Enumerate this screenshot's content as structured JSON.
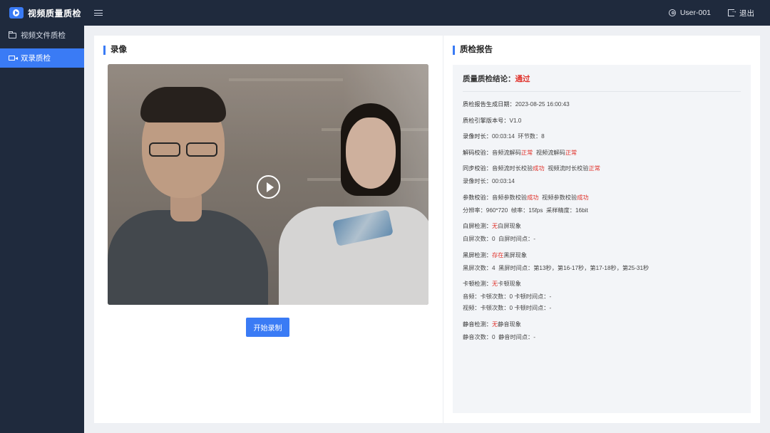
{
  "app": {
    "title": "视频质量质检"
  },
  "header": {
    "user": "User-001",
    "logout": "退出"
  },
  "sidebar": {
    "items": [
      {
        "label": "视频文件质检",
        "active": false
      },
      {
        "label": "双录质检",
        "active": true
      }
    ]
  },
  "recording": {
    "title": "录像",
    "start_button": "开始录制"
  },
  "report": {
    "title": "质检报告",
    "conclusion_label": "质量质检结论：",
    "conclusion_value": "通过",
    "lines": {
      "gen_date_label": "质检报告生成日期：",
      "gen_date": "2023-08-25 16:00:43",
      "engine_label": "质检引擎版本号：",
      "engine": "V1.0",
      "duration_label": "录像时长：",
      "duration": "00:03:14",
      "segments_label": "环节数：",
      "segments": "8",
      "decode_label": "解码校验：",
      "decode_audio": "音频流解码",
      "decode_audio_status": "正常",
      "decode_video": "视频流解码",
      "decode_video_status": "正常",
      "sync_label": "同步校验：",
      "sync_audio": "音频流时长校验",
      "sync_audio_status": "成功",
      "sync_video": "视频流时长校验",
      "sync_video_status": "正常",
      "rec_duration_label": "录像时长：",
      "rec_duration": "00:03:14",
      "param_label": "参数校验：",
      "param_audio": "音频参数校验",
      "param_audio_status": "成功",
      "param_video": "视频参数校验",
      "param_video_status": "成功",
      "resolution_label": "分辨率：",
      "resolution": "960*720",
      "fps_label": "帧率：",
      "fps": "15fps",
      "bitdepth_label": "采样精度：",
      "bitdepth": "16bit",
      "white_label": "白屏检测：",
      "white_status": "无",
      "white_text": "白屏现象",
      "white_count_label": "白屏次数：",
      "white_count": "0",
      "white_time_label": "白屏时间点：",
      "white_time": "-",
      "black_label": "黑屏检测：",
      "black_status": "存在",
      "black_text": "黑屏现象",
      "black_count_label": "黑屏次数：",
      "black_count": "4",
      "black_time_label": "黑屏时间点：",
      "black_time": "第13秒，第16-17秒，第17-18秒，第25-31秒",
      "lag_label": "卡顿检测：",
      "lag_status": "无",
      "lag_text": "卡顿现象",
      "lag_audio": "音频：卡顿次数：0   卡顿时间点：-",
      "lag_video": "视频：卡顿次数：0   卡顿时间点：-",
      "mute_label": "静音检测：",
      "mute_status": "无",
      "mute_text": "静音现象",
      "mute_count_label": "静音次数：",
      "mute_count": "0",
      "mute_time_label": "静音时间点：",
      "mute_time": "-"
    }
  },
  "icons": [
    "logo-icon",
    "menu-icon",
    "user-icon",
    "logout-icon",
    "folder-icon",
    "camera-icon",
    "play-icon"
  ],
  "colors": {
    "accent": "#3a7bf5",
    "nav_bg": "#1f2a3d",
    "status_red": "#e0322b"
  }
}
